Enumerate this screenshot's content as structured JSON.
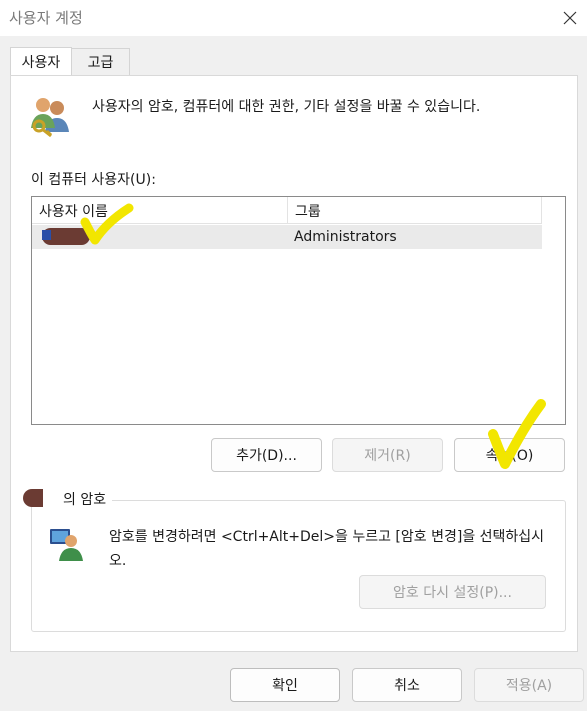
{
  "window": {
    "title": "사용자 계정",
    "close_icon": "close-icon"
  },
  "tabs": [
    {
      "label": "사용자",
      "active": true
    },
    {
      "label": "고급",
      "active": false
    }
  ],
  "intro": {
    "icon": "users-keys-icon",
    "text": "사용자의 암호, 컴퓨터에 대한 권한, 기타 설정을 바꿀 수 있습니다."
  },
  "users_section": {
    "label": "이 컴퓨터 사용자(U):",
    "columns": [
      "사용자 이름",
      "그룹"
    ],
    "rows": [
      {
        "user_name": "",
        "group": "Administrators"
      }
    ]
  },
  "buttons": {
    "add": "추가(D)...",
    "remove": "제거(R)",
    "properties": "속성(O)"
  },
  "password_group": {
    "title": "의 암호",
    "icon": "user-password-icon",
    "description": "암호를 변경하려면 <Ctrl+Alt+Del>을 누르고 [암호 변경]을 선택하십시오.",
    "reset_button": "암호 다시 설정(P)..."
  },
  "footer": {
    "ok": "확인",
    "cancel": "취소",
    "apply": "적용(A)"
  },
  "colors": {
    "annotation_check": "#f2e600",
    "redaction": "#6b3b33"
  }
}
